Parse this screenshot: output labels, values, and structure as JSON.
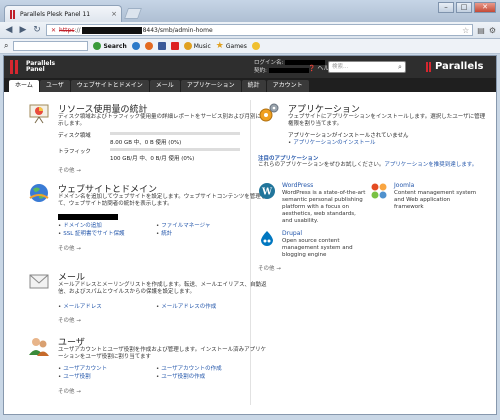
{
  "browser": {
    "tab_title": "Parallels Plesk Panel 11",
    "tab_close": "×",
    "url_scheme": "https",
    "url_visible": "8443/smb/admin-home",
    "win_min": "–",
    "win_max": "□",
    "win_close": "✕",
    "toolbar": {
      "search_label": "Search",
      "music_label": "Music",
      "games_label": "Games"
    }
  },
  "panel": {
    "logo_line1": "Parallels",
    "logo_line2": "Panel",
    "login_label": "ログイン名:",
    "subscription_label": "契約:",
    "help_label": "ヘルプ",
    "search_placeholder": "検索...",
    "brand": "Parallels",
    "nav": [
      {
        "label": "ホーム",
        "active": true
      },
      {
        "label": "ユーザ",
        "active": false
      },
      {
        "label": "ウェブサイトとドメイン",
        "active": false
      },
      {
        "label": "メール",
        "active": false
      },
      {
        "label": "アプリケーション",
        "active": false
      },
      {
        "label": "統計",
        "active": false
      },
      {
        "label": "アカウント",
        "active": false
      }
    ]
  },
  "sections": {
    "resources": {
      "title": "リソース使用量の統計",
      "desc": "ディスク領域およびトラフィック使用量の詳細レポートをサービス別および月別に表示します。",
      "disk_label": "ディスク領域",
      "disk_value": "8.00 GB 中、0 B 使用 (0%)",
      "disk_fraction": 0,
      "traffic_label": "トラフィック",
      "traffic_value": "100 GB/月 中、0 B/月 使用 (0%)",
      "traffic_fraction": 0,
      "more": "その他 →"
    },
    "websites": {
      "title": "ウェブサイトとドメイン",
      "desc": "ドメイン名を追加してウェブサイトを設定します。ウェブサイトコンテンツを管理して、ウェブサイト訪問者の統計を表示します。",
      "links": [
        "ドメインの追加",
        "SSL 証明書でサイト保護",
        "ファイルマネージャ",
        "統計"
      ],
      "more": "その他 →"
    },
    "mail": {
      "title": "メール",
      "desc": "メールアドレスとメーリングリストを作成します。転送、メールエイリアス、自動返信、およびスパムとウイルスからの保護を設定します。",
      "links": [
        "メールアドレス",
        "メールアドレスの作成"
      ],
      "more": "その他 →"
    },
    "users": {
      "title": "ユーザ",
      "desc": "ユーザアカウントとユーザ役割を作成および管理します。インストール済みアプリケーションをユーザ役割に割り当てます",
      "links": [
        "ユーザアカウント",
        "ユーザ役割",
        "ユーザアカウントの作成",
        "ユーザ役割の作成"
      ],
      "more": "その他 →"
    },
    "applications": {
      "title": "アプリケーション",
      "desc": "ウェブサイトにアプリケーションをインストールします。選択したユーザに管理権限を割り当てます。",
      "none_installed": "アプリケーションがインストールされていません",
      "install_link": "アプリケーションのインストール",
      "featured_title": "注目のアプリケーション",
      "featured_desc_prefix": "これらのアプリケーションをぜひお試しください。",
      "featured_desc_link": "アプリケーションを推奨到達します。",
      "apps": [
        {
          "name": "WordPress",
          "desc": "WordPress is a state-of-the-art semantic personal publishing platform with a focus on aesthetics, web standards, and usability."
        },
        {
          "name": "Joomla",
          "desc": "Content management system and Web application framework"
        },
        {
          "name": "Drupal",
          "desc": "Open source content management system and blogging engine"
        }
      ],
      "more": "その他 →"
    }
  }
}
